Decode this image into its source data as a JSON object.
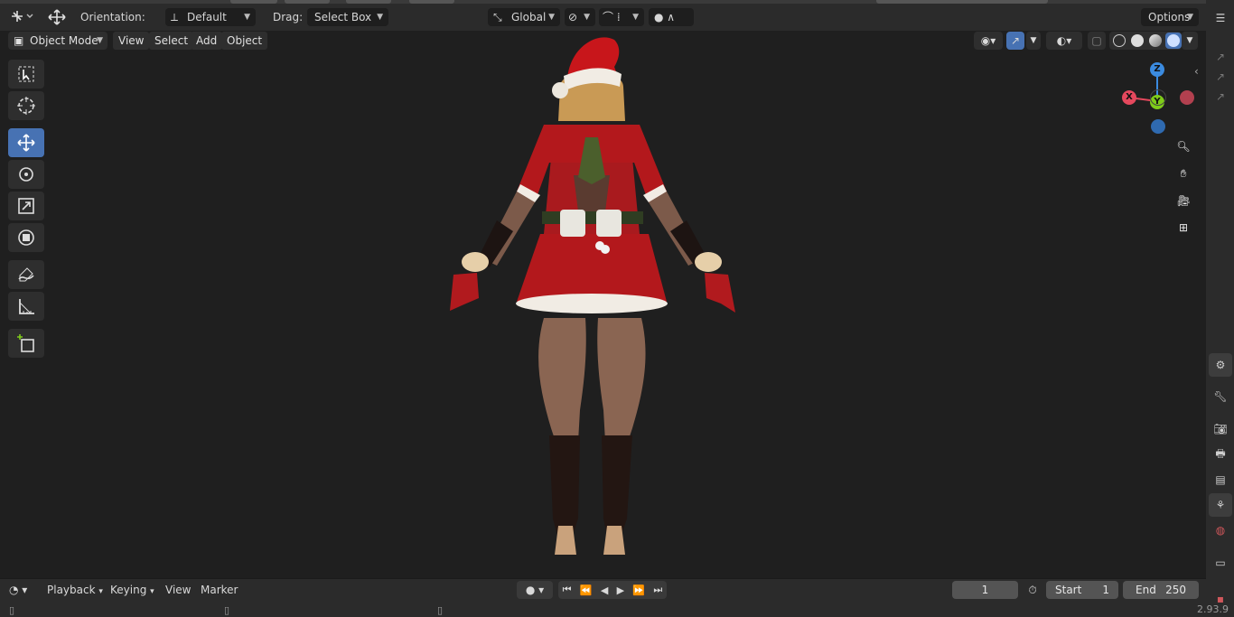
{
  "app": {
    "version": "2.93.9"
  },
  "header": {
    "orientation_label": "Orientation:",
    "orientation_value": "Default",
    "drag_label": "Drag:",
    "drag_value": "Select Box",
    "transform_space": "Global",
    "options_label": "Options"
  },
  "viewport_header": {
    "mode": "Object Mode",
    "menus": [
      "View",
      "Select",
      "Add",
      "Object"
    ]
  },
  "toolbar": {
    "tools": [
      {
        "name": "select-box-tool",
        "icon": "select-box-icon",
        "active": false
      },
      {
        "name": "cursor-tool",
        "icon": "cursor-icon",
        "active": false
      },
      {
        "name": "move-tool",
        "icon": "move-icon",
        "active": true
      },
      {
        "name": "rotate-tool",
        "icon": "rotate-icon",
        "active": false
      },
      {
        "name": "scale-tool",
        "icon": "scale-icon",
        "active": false
      },
      {
        "name": "transform-tool",
        "icon": "transform-icon",
        "active": false
      },
      {
        "name": "annotate-tool",
        "icon": "annotate-icon",
        "active": false
      },
      {
        "name": "measure-tool",
        "icon": "measure-icon",
        "active": false
      },
      {
        "name": "add-cube-tool",
        "icon": "add-cube-icon",
        "active": false
      }
    ]
  },
  "gizmo": {
    "x": "X",
    "y": "Y",
    "z": "Z"
  },
  "timeline": {
    "menus": [
      "Playback",
      "Keying",
      "View",
      "Marker"
    ],
    "current_frame": "1",
    "start_label": "Start",
    "start_value": "1",
    "end_label": "End",
    "end_value": "250"
  },
  "colors": {
    "accent": "#4772b3",
    "axis_x": "#e5485d",
    "axis_y": "#7fcc1a",
    "axis_z": "#3b8be0"
  }
}
